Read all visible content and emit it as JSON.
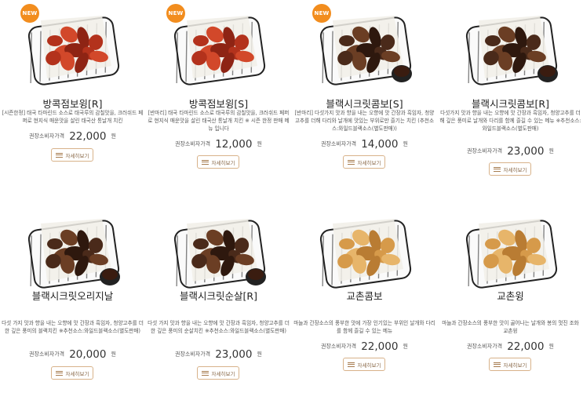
{
  "products": [
    {
      "badge": "NEW",
      "name": "방콕점보윙[R]",
      "desc": "[시즌한정] 태국 타마린드 소스로 태국루의 감칠맛을, 크러쉬드 페퍼로 현지식 매운맛을 살린 태국산 통날개 치킨",
      "price_label": "권장소비자가격",
      "price": "22,000",
      "unit": "원",
      "button": "자세히보기",
      "food": "red"
    },
    {
      "badge": "NEW",
      "name": "방콕점보윙[S]",
      "desc": "[반마리] 태국 타마린드 소스로 태국루의 감칠맛을, 크러쉬드 페퍼로 현지식 매운맛을 살린 태국산 통날개 치킨 ※ 시즌 한정 판매 메뉴 입니다",
      "price_label": "권장소비자가격",
      "price": "12,000",
      "unit": "원",
      "button": "자세히보기",
      "food": "red"
    },
    {
      "badge": "NEW",
      "name": "블랙시크릿콤보[S]",
      "desc": "[반마리] 다섯가지 맛과 향을 내는 오향에 맛 간장과 흑임자, 청양고추를 더해 다리와 날개에 맛있는 부위로만 즐기는 치킨 (추천소스:와일드블랙소스(별도판매))",
      "price_label": "권장소비자가격",
      "price": "14,000",
      "unit": "원",
      "button": "자세히보기",
      "food": "dark"
    },
    {
      "badge": "",
      "name": "블랙시크릿콤보[R]",
      "desc": "다섯가지 맛과 향을 내는 오향에 맛 간장과 흑임자, 청양고추를 더해 깊은 풍미로 날개와 다리를 함께 즐길 수 있는 메뉴 ※추천소스:와일드블랙소스(별도판매)",
      "price_label": "권장소비자가격",
      "price": "23,000",
      "unit": "원",
      "button": "자세히보기",
      "food": "dark"
    },
    {
      "badge": "",
      "name": "블랙시크릿오리지날",
      "desc": "다섯 가지 맛과 향을 내는 오향에 맛 간장과 흑임자, 청양고추를 더한 깊은 풍미의 블랙치킨 ※추천소스:와일드블랙소스(별도판매)",
      "price_label": "권장소비자가격",
      "price": "20,000",
      "unit": "원",
      "button": "자세히보기",
      "food": "dark"
    },
    {
      "badge": "",
      "name": "블랙시크릿순살[R]",
      "desc": "다섯 가지 맛과 향을 내는 오향에 맛 간장과 흑임자, 청양고추를 더한 깊은 풍미의 순살치킨 ※추천소스:와일드블랙소스(별도판매)",
      "price_label": "권장소비자가격",
      "price": "23,000",
      "unit": "원",
      "button": "자세히보기",
      "food": "dark"
    },
    {
      "badge": "",
      "name": "교촌콤보",
      "desc": "마늘과 간장소스의 풍부한 맛에 가장 인기있는 부위인 날개와 다리를 함께 즐길 수 있는 메뉴",
      "price_label": "권장소비자가격",
      "price": "22,000",
      "unit": "원",
      "button": "자세히보기",
      "food": "golden"
    },
    {
      "badge": "",
      "name": "교촌윙",
      "desc": "마늘과 간장소스의 풍부한 맛이 골어나는 날개와 봉의 멋진 조화 교촌윙",
      "price_label": "권장소비자가격",
      "price": "22,000",
      "unit": "원",
      "button": "자세히보기",
      "food": "golden"
    }
  ],
  "colors": {
    "badge": "#f28d1e",
    "button_border": "#d8b28a",
    "red_chicken": "#b3321c",
    "dark_chicken": "#4a2a1a",
    "golden_chicken": "#d69a4a"
  }
}
